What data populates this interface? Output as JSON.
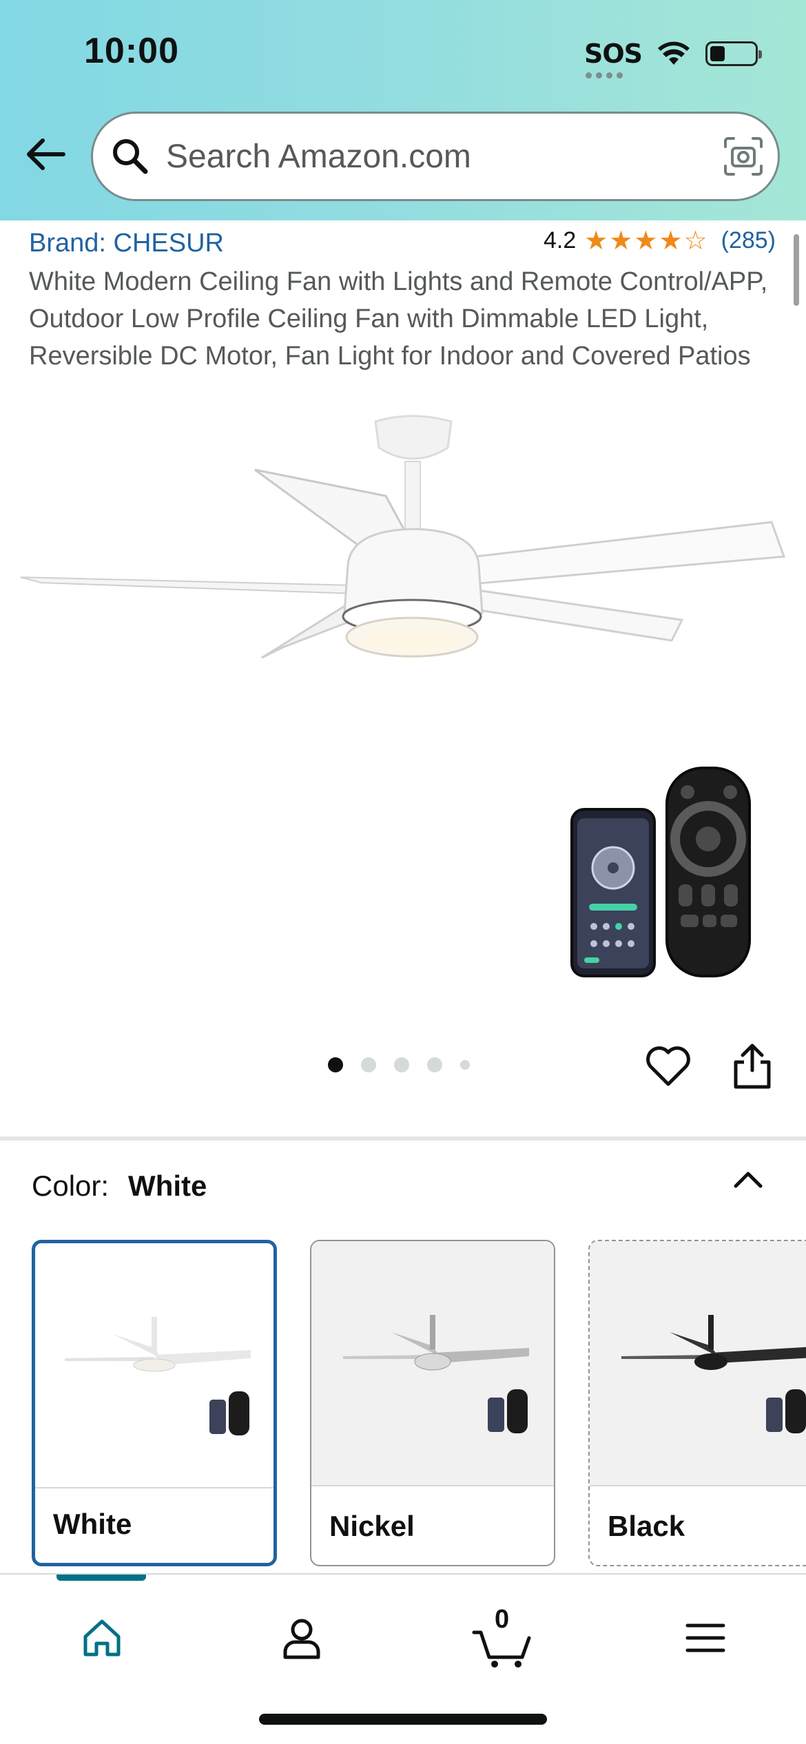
{
  "status_bar": {
    "time": "10:00",
    "sos": "SOS"
  },
  "search": {
    "placeholder": "Search Amazon.com"
  },
  "product": {
    "brand": "Brand: CHESUR",
    "rating": "4.2",
    "rating_value": 4.2,
    "review_count": "(285)",
    "title": "White Modern Ceiling Fan with Lights and Remote Control/APP, Outdoor Low Profile Ceiling Fan with Dimmable LED Light, Reversible DC Motor, Fan Light for Indoor and Covered Patios",
    "image_index": 1,
    "image_count": 5
  },
  "variation": {
    "label": "Color:",
    "selected": "White",
    "options": [
      {
        "name": "White",
        "selected": true
      },
      {
        "name": "Nickel",
        "selected": false
      },
      {
        "name": "Black",
        "selected": false
      }
    ]
  },
  "bottom_nav": {
    "cart_count": "0",
    "items": [
      "home-icon",
      "account-icon",
      "cart-icon",
      "menu-icon"
    ]
  },
  "colors": {
    "link": "#2162a1",
    "star": "#ef8a1a",
    "selected_border": "#2162a1",
    "nav_active": "#007185"
  }
}
